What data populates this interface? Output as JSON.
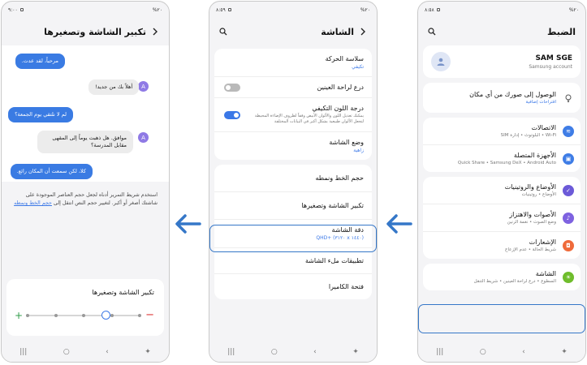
{
  "status": {
    "left": "٩:٠٠",
    "mid": "٨:٥٩",
    "right": "٨:٥٨",
    "battery": "%٢٠"
  },
  "phone_right": {
    "title": "الضبط",
    "profile": {
      "name": "SAM SGE",
      "account": "Samsung account"
    },
    "suggestion": {
      "label": "الوصول إلى صورك من أي مكان",
      "sub": "اقتراحات إضافية"
    },
    "items": [
      {
        "label": "الاتصالات",
        "sub": "Wi-Fi • البلوتوث • إدارة SIM",
        "icon": "wifi-icon",
        "color": "#3f7de6"
      },
      {
        "label": "الأجهزة المتصلة",
        "sub": "Quick Share • Samsung DeX • Android Auto",
        "icon": "devices-icon",
        "color": "#3f7de6"
      },
      {
        "label": "الأوضاع والروتينيات",
        "sub": "الأوضاع • روتينيات",
        "icon": "modes-icon",
        "color": "#6c5ad8"
      },
      {
        "label": "الأصوات والاهتزاز",
        "sub": "وضع الصوت • نغمة الرنين",
        "icon": "sound-icon",
        "color": "#7e62e0"
      },
      {
        "label": "الإشعارات",
        "sub": "شريط الحالة • عدم الإزعاج",
        "icon": "notification-icon",
        "color": "#ef6a3a"
      },
      {
        "label": "الشاشة",
        "sub": "السطوع • درع لراحة العينين • شريط التنقل",
        "icon": "display-icon",
        "color": "#6fbd2c"
      }
    ]
  },
  "phone_mid": {
    "title": "الشاشة",
    "motion": {
      "label": "سلاسة الحركة",
      "sub": "تكيفي"
    },
    "eye": {
      "label": "درع لراحة العينين"
    },
    "adaptive": {
      "label": "درجة اللون التكيفي",
      "sub": "يمكنك تعديل اللون والألوان الأبيض وفقاً لظروف الإضاءة المحيطة لتجعل الألوان طبيعية بشكل أكبر في البيانات المختلفة"
    },
    "mode": {
      "label": "وضع الشاشة",
      "sub": "زاهية"
    },
    "font": {
      "label": "حجم الخط ونمطه"
    },
    "zoom": {
      "label": "تكبير الشاشة وتصغيرها"
    },
    "resolution": {
      "label": "دقة الشاشة",
      "sub": "QHD+ (٣١٢٠ x ١٤٤٠)"
    },
    "fullscreen": {
      "label": "تطبيقات ملء الشاشة"
    },
    "camera": {
      "label": "فتحة الكاميرا"
    }
  },
  "phone_left": {
    "title": "تكبير الشاشة وتصغيرها",
    "chat": [
      "مرحباً، لقد عدت.",
      "أهلاً بك من جديد!",
      "لم لا نلتقي يوم الجمعة؟",
      "موافق. هل ذهبت يوماً إلى المقهى مقابل المدرسة؟",
      "كلا، لكن سمعت أن المكان رائع."
    ],
    "avatar_letter": "A",
    "description": "استخدم شريط التمرير أدناه لجعل حجم العناصر الموجودة على شاشتك أصغر أو أكبر. لتغيير حجم النص انتقل إلى",
    "description_link": "حجم الخط ونمطه",
    "zoom_title": "تكبير الشاشة وتصغيرها",
    "slider_value": 0.7,
    "slider_steps": 5
  },
  "colors": {
    "accent": "#3577c8",
    "bubble_out": "#3a7be3"
  }
}
